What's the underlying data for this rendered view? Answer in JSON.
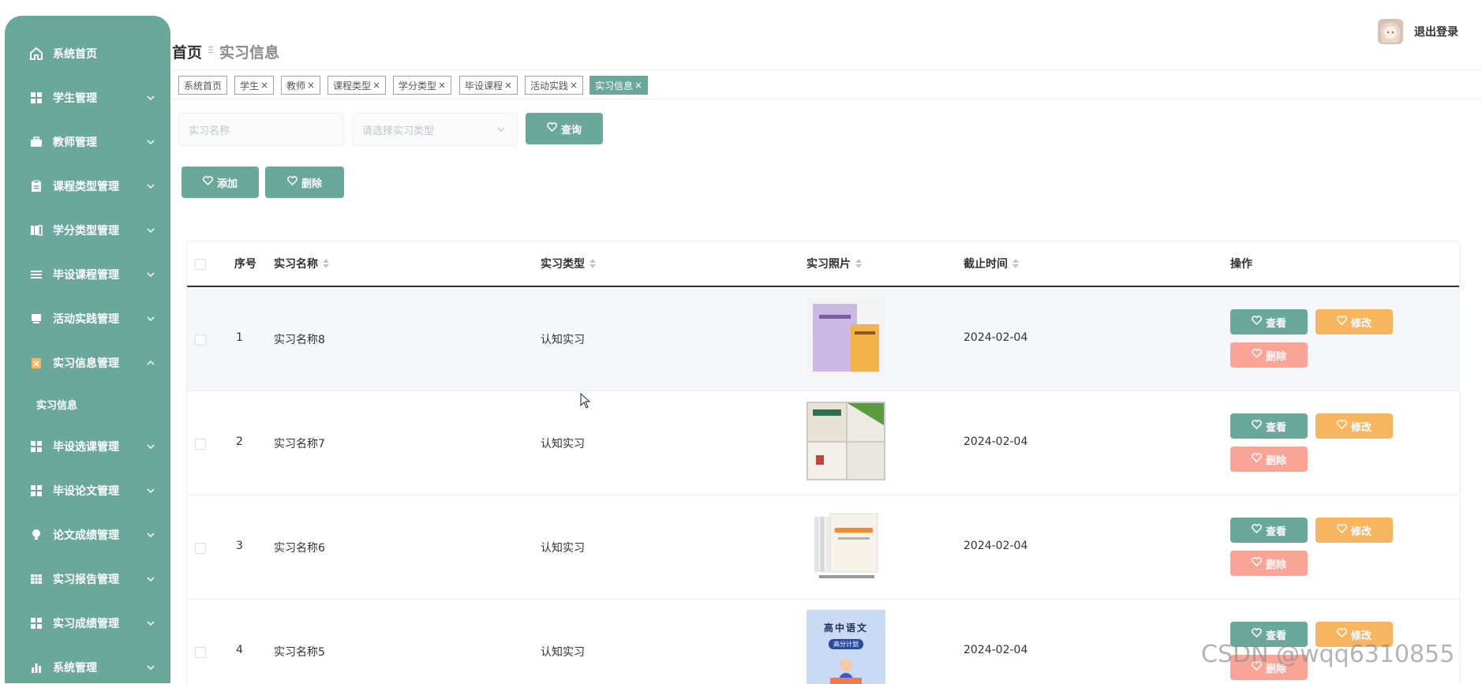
{
  "sidebar": {
    "items": [
      {
        "label": "系统首页",
        "icon": "home-icon"
      },
      {
        "label": "学生管理",
        "icon": "grid-icon"
      },
      {
        "label": "教师管理",
        "icon": "briefcase-icon"
      },
      {
        "label": "课程类型管理",
        "icon": "clipboard-icon"
      },
      {
        "label": "学分类型管理",
        "icon": "columns-icon"
      },
      {
        "label": "毕设课程管理",
        "icon": "list-icon"
      },
      {
        "label": "活动实践管理",
        "icon": "monitor-icon"
      },
      {
        "label": "实习信息管理",
        "icon": "document-icon"
      },
      {
        "label": "毕设选课管理",
        "icon": "grid-icon"
      },
      {
        "label": "毕设论文管理",
        "icon": "grid-icon"
      },
      {
        "label": "论文成绩管理",
        "icon": "bulb-icon"
      },
      {
        "label": "实习报告管理",
        "icon": "table-icon"
      },
      {
        "label": "实习成绩管理",
        "icon": "grid-icon"
      },
      {
        "label": "系统管理",
        "icon": "bar-chart-icon"
      }
    ],
    "submenu": {
      "label": "实习信息"
    }
  },
  "header": {
    "breadcrumb_home": "首页",
    "breadcrumb_current": "实习信息",
    "logout": "退出登录"
  },
  "tags": [
    {
      "label": "系统首页",
      "closable": false
    },
    {
      "label": "学生",
      "closable": true
    },
    {
      "label": "教师",
      "closable": true
    },
    {
      "label": "课程类型",
      "closable": true
    },
    {
      "label": "学分类型",
      "closable": true
    },
    {
      "label": "毕设课程",
      "closable": true
    },
    {
      "label": "活动实践",
      "closable": true
    },
    {
      "label": "实习信息",
      "closable": true,
      "active": true
    }
  ],
  "tag_close": "×",
  "search": {
    "name_placeholder": "实习名称",
    "type_placeholder": "请选择实习类型",
    "query_label": "查询"
  },
  "actions": {
    "add_label": "添加",
    "delete_label": "删除"
  },
  "table": {
    "columns": [
      "序号",
      "实习名称",
      "实习类型",
      "实习照片",
      "截止时间",
      "操作"
    ],
    "rows": [
      {
        "index": "1",
        "name": "实习名称8",
        "type": "认知实习",
        "date": "2024-02-04"
      },
      {
        "index": "2",
        "name": "实习名称7",
        "type": "认知实习",
        "date": "2024-02-04"
      },
      {
        "index": "3",
        "name": "实习名称6",
        "type": "认知实习",
        "date": "2024-02-04"
      },
      {
        "index": "4",
        "name": "实习名称5",
        "type": "认知实习",
        "date": "2024-02-04"
      }
    ],
    "row_actions": {
      "view": "查看",
      "edit": "修改",
      "delete": "删除"
    },
    "photo_text": {
      "book4_title": "高中语文",
      "book4_sub": "高分计划"
    }
  },
  "watermark": "CSDN @wqq6310855",
  "colors": {
    "primary": "#6aa89b",
    "warning": "#f7b55f",
    "danger": "#f9a497"
  }
}
